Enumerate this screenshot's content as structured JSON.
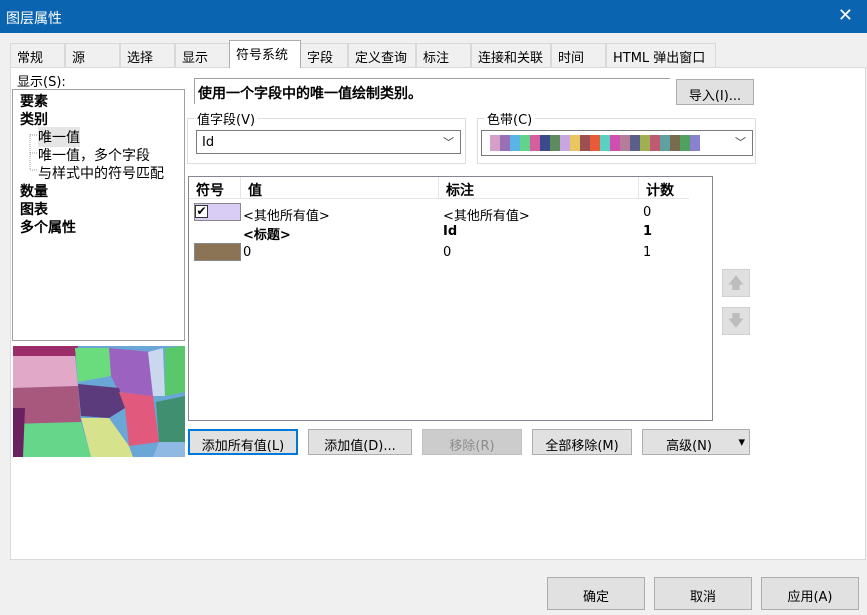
{
  "window": {
    "title": "图层属性",
    "close_glyph": "✕"
  },
  "tabs": [
    {
      "label": "常规"
    },
    {
      "label": "源"
    },
    {
      "label": "选择"
    },
    {
      "label": "显示"
    },
    {
      "label": "符号系统",
      "active": true
    },
    {
      "label": "字段"
    },
    {
      "label": "定义查询"
    },
    {
      "label": "标注"
    },
    {
      "label": "连接和关联"
    },
    {
      "label": "时间"
    },
    {
      "label": "HTML 弹出窗口"
    }
  ],
  "show": {
    "label": "显示(S):",
    "items": [
      {
        "label": "要素"
      },
      {
        "label": "类别"
      },
      {
        "label": "唯一值"
      },
      {
        "label": "唯一值，多个字段"
      },
      {
        "label": "与样式中的符号匹配"
      },
      {
        "label": "数量"
      },
      {
        "label": "图表"
      },
      {
        "label": "多个属性"
      }
    ]
  },
  "description": "使用一个字段中的唯一值绘制类别。",
  "import_button": "导入(I)...",
  "value_field": {
    "label": "值字段(V)",
    "value": "Id"
  },
  "color_ramp": {
    "label": "色带(C)",
    "colors": [
      "#d5a0c8",
      "#9b6fb5",
      "#5ab4e5",
      "#62d38a",
      "#d55e9d",
      "#3a4a8c",
      "#5e8b5e",
      "#c8a6e0",
      "#e8c85e",
      "#9a5050",
      "#e85a3a",
      "#5ad0c0",
      "#d04eb0",
      "#b47e9a",
      "#5a5e8a",
      "#a0b050",
      "#c05a70",
      "#60a0a0",
      "#7a6a50",
      "#50a060",
      "#8a80d0"
    ]
  },
  "table": {
    "headers": {
      "symbol": "符号",
      "value": "值",
      "label": "标注",
      "count": "计数"
    },
    "rows": [
      {
        "swatch": "#d9ccf5",
        "checked": true,
        "value": "<其他所有值>",
        "label": "<其他所有值>",
        "count": "0"
      },
      {
        "header": true,
        "value": "<标题>",
        "label": "Id",
        "count": "1"
      },
      {
        "swatch": "#8b7355",
        "value": "0",
        "label": "0",
        "count": "1"
      }
    ]
  },
  "buttons": {
    "add_all": "添加所有值(L)",
    "add": "添加值(D)...",
    "remove": "移除(R)",
    "remove_all": "全部移除(M)",
    "advanced": "高级(N)",
    "ok": "确定",
    "cancel": "取消",
    "apply": "应用(A)"
  },
  "icons": {
    "up": "🡅",
    "down": "🡇",
    "dropdown": "﹀",
    "check": "✔",
    "small_down": "▾"
  }
}
